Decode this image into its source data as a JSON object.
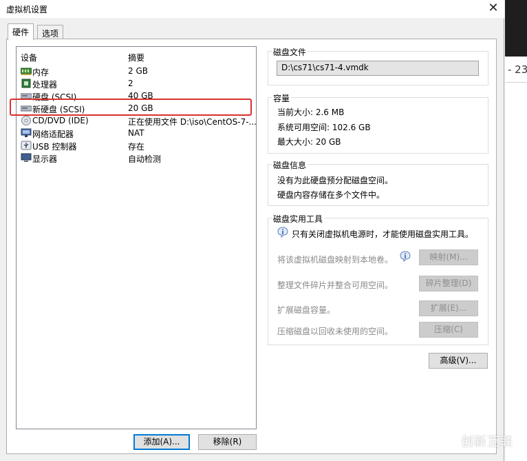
{
  "window": {
    "title": "虚拟机设置",
    "close_label": "✕"
  },
  "tabs": [
    {
      "label": "硬件"
    },
    {
      "label": "选项"
    }
  ],
  "device_list": {
    "columns": [
      "设备",
      "摘要"
    ],
    "rows": [
      {
        "name": "内存",
        "summary": "2 GB",
        "icon": "memory-icon"
      },
      {
        "name": "处理器",
        "summary": "2",
        "icon": "processor-icon"
      },
      {
        "name": "硬盘 (SCSI)",
        "summary": "40 GB",
        "icon": "hard-disk-icon"
      },
      {
        "name": "新硬盘 (SCSI)",
        "summary": "20 GB",
        "icon": "hard-disk-icon"
      },
      {
        "name": "CD/DVD (IDE)",
        "summary": "正在使用文件 D:\\iso\\CentOS-7-...",
        "icon": "cd-dvd-icon"
      },
      {
        "name": "网络适配器",
        "summary": "NAT",
        "icon": "network-adapter-icon"
      },
      {
        "name": "USB 控制器",
        "summary": "存在",
        "icon": "usb-icon"
      },
      {
        "name": "显示器",
        "summary": "自动检测",
        "icon": "monitor-icon"
      }
    ],
    "add_label": "添加(A)...",
    "remove_label": "移除(R)"
  },
  "disk_file": {
    "label": "磁盘文件",
    "value": "D:\\cs71\\cs71-4.vmdk"
  },
  "capacity": {
    "label": "容量",
    "current": "当前大小: 2.6 MB",
    "available": "系统可用空间: 102.6 GB",
    "max": "最大大小: 20 GB"
  },
  "disk_info": {
    "label": "磁盘信息",
    "line1": "没有为此硬盘预分配磁盘空间。",
    "line2": "硬盘内容存储在多个文件中。"
  },
  "disk_utilities": {
    "label": "磁盘实用工具",
    "notice": "只有关闭虚拟机电源时，才能使用磁盘实用工具。",
    "items": [
      {
        "text": "将该虚拟机磁盘映射到本地卷。",
        "button": "映射(M)..."
      },
      {
        "text": "整理文件碎片并整合可用空间。",
        "button": "碎片整理(D)"
      },
      {
        "text": "扩展磁盘容量。",
        "button": "扩展(E)..."
      },
      {
        "text": "压缩磁盘以回收未使用的空间。",
        "button": "压缩(C)"
      }
    ]
  },
  "advanced_label": "高级(V)...",
  "background": {
    "clock": "- 23:"
  },
  "watermark": {
    "text": "创新互联"
  }
}
